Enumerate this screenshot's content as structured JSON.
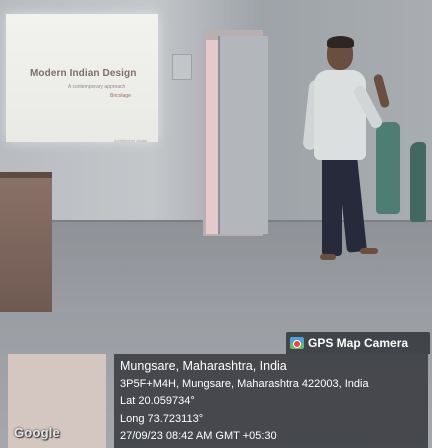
{
  "projection": {
    "slide_title": "Modern Indian Design",
    "slide_subtitle": "A contemporary approach",
    "slide_tag": "Bricolage",
    "slide_footer": "Architecture studio"
  },
  "overlay": {
    "app_name": "GPS Map Camera",
    "map_logo": "Google",
    "location_title": "Mungsare, Maharashtra, India",
    "address": "3P5F+M4H, Mungsare, Maharashtra 422003, India",
    "latitude": "Lat 20.059734°",
    "longitude": "Long 73.723113°",
    "datetime": "27/09/23 08:42 AM GMT +05:30"
  },
  "icons": {
    "camera": "gps-map-camera-icon"
  },
  "colors": {
    "overlay_bg": "#3c3e42",
    "map_thumb": "#d4c6c1"
  }
}
